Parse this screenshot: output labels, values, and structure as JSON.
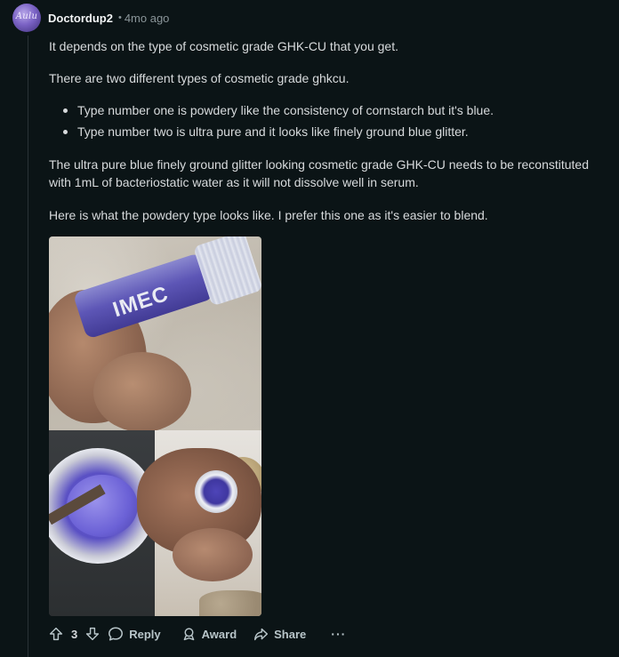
{
  "comment": {
    "avatar_text": "Aulu",
    "username": "Doctordup2",
    "separator": "•",
    "time": "4mo ago",
    "paragraphs": [
      "It depends on the type of cosmetic grade GHK-CU that you get.",
      "There are two different types of cosmetic grade ghkcu.",
      "The ultra pure blue finely ground glitter looking cosmetic grade GHK-CU needs to be reconstituted with 1mL of bacteriostatic water as it will not dissolve well in serum.",
      "Here is what the powdery type looks like. I prefer this one as it's easier to blend."
    ],
    "list_items": [
      "Type number one is powdery like the consistency of cornstarch but it's blue.",
      "Type number two is ultra pure and it looks like finely ground blue glitter."
    ],
    "image": {
      "vial_label": "IMEC"
    }
  },
  "actions": {
    "score": "3",
    "reply_label": "Reply",
    "award_label": "Award",
    "share_label": "Share",
    "more_label": "···"
  },
  "icons": {
    "upvote": "upvote-arrow-icon",
    "downvote": "downvote-arrow-icon",
    "reply": "speech-bubble-icon",
    "award": "award-ribbon-icon",
    "share": "share-arrow-icon"
  },
  "colors": {
    "background": "#0b1416",
    "text": "#d7dadc",
    "muted": "#8a9599",
    "username": "#f2f4f5"
  }
}
